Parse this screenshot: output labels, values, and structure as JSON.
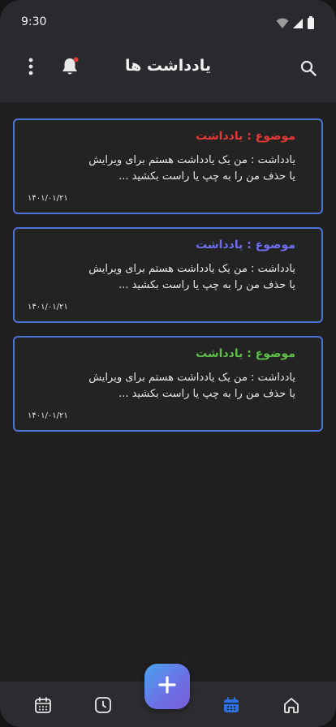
{
  "status_bar": {
    "time": "9:30",
    "icons": [
      "wifi-icon",
      "signal-icon",
      "battery-icon"
    ]
  },
  "app_bar": {
    "title": "یادداشت ها",
    "icons": {
      "menu": "more-vert-icon",
      "notifications": "bell-icon",
      "search": "search-icon"
    },
    "notification_dot_color": "#e53935"
  },
  "notes": [
    {
      "title": "موضوع : یادداشت",
      "title_color": "#e53935",
      "body_line1": "یادداشت : من یک یادداشت هستم برای ویرایش",
      "body_line2": "یا حذف من را به چپ یا راست بکشید ...",
      "date": "۱۴۰۱/۰۱/۲۱"
    },
    {
      "title": "موضوع : یادداشت",
      "title_color": "#6f6ef0",
      "body_line1": "یادداشت : من یک یادداشت هستم برای ویرایش",
      "body_line2": "یا حذف من را به چپ یا راست بکشید ...",
      "date": "۱۴۰۱/۰۱/۲۱"
    },
    {
      "title": "موضوع : یادداشت",
      "title_color": "#5fbf4a",
      "body_line1": "یادداشت : من یک یادداشت هستم برای ویرایش",
      "body_line2": "یا حذف من را به چپ یا راست بکشید ...",
      "date": "۱۴۰۱/۰۱/۲۱"
    }
  ],
  "colors": {
    "card_border": "#4c74d6",
    "active_nav": "#2f6fe0",
    "inactive_nav": "#e8e8e8"
  },
  "bottom_nav": {
    "items": [
      "calendar-grid-icon",
      "clock-icon",
      "calendar-active-icon",
      "home-icon"
    ],
    "fab_icon": "plus-icon"
  }
}
